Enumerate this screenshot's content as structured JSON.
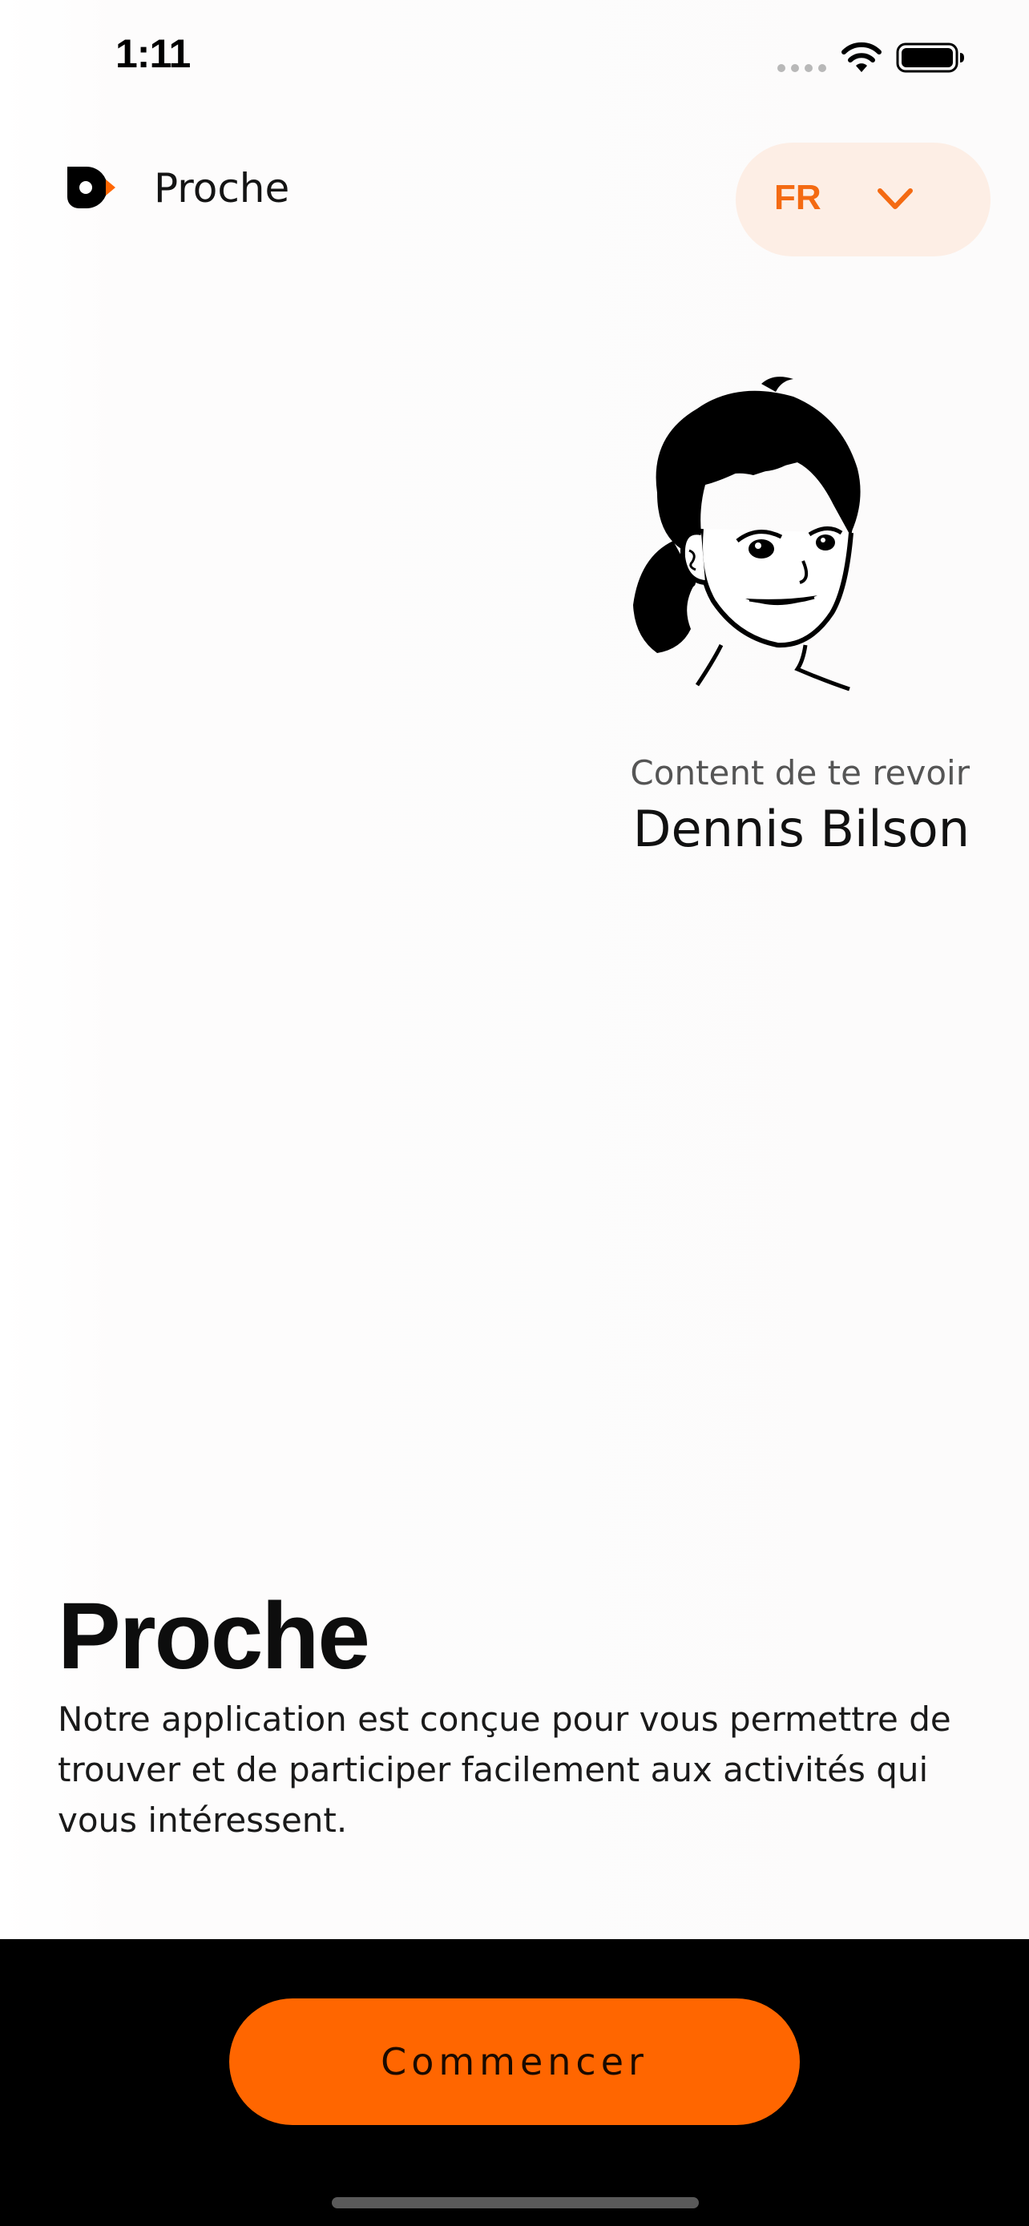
{
  "status_bar": {
    "time": "1:11",
    "icons": [
      "cellular-signal-icon",
      "wifi-icon",
      "battery-icon"
    ]
  },
  "header": {
    "app_name": "Proche",
    "logo_icon": "proche-logo-icon",
    "language": {
      "selected": "FR",
      "icon": "chevron-down-icon"
    }
  },
  "profile": {
    "avatar_icon": "user-avatar-illustration",
    "greeting": "Content de te revoir",
    "name": "Dennis Bilson"
  },
  "hero": {
    "title": "Proche",
    "description": "Notre application est conçue pour vous permettre de trouver et de participer facilement aux activités qui vous intéressent."
  },
  "footer": {
    "start_label": "Commencer"
  },
  "colors": {
    "accent": "#ff6600",
    "accent_light": "#fdeee5",
    "text_dark": "#111111",
    "text_muted": "#555555",
    "footer_bg": "#000000"
  }
}
